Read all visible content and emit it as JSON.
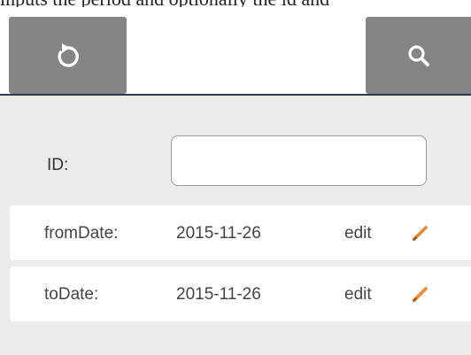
{
  "header": {
    "overflow_text": "inputs the period and optionally the id and"
  },
  "toolbar": {
    "refresh_icon": "refresh-icon",
    "search_icon": "search-icon",
    "button_color": "#858585"
  },
  "form": {
    "id_label": "ID:",
    "id_value": "",
    "id_placeholder": ""
  },
  "dates": [
    {
      "label": "fromDate:",
      "value": "2015-11-26",
      "edit_label": "edit",
      "edit_icon": "pencil-icon"
    },
    {
      "label": "toDate:",
      "value": "2015-11-26",
      "edit_label": "edit",
      "edit_icon": "pencil-icon"
    }
  ],
  "colors": {
    "accent": "#e8892f",
    "divider": "#2f3a44",
    "background": "#ebebeb"
  }
}
